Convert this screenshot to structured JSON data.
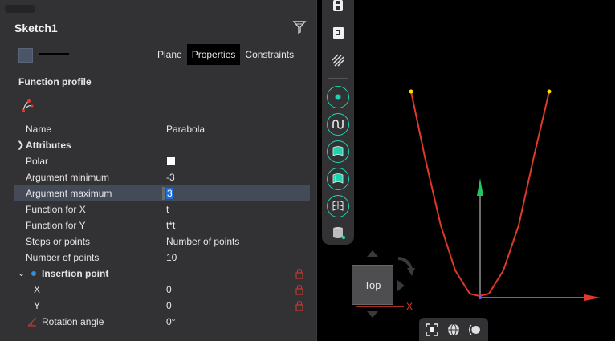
{
  "panel": {
    "title": "Sketch1",
    "tabs": [
      {
        "label": "Plane"
      },
      {
        "label": "Properties"
      },
      {
        "label": "Constraints"
      }
    ],
    "section_title": "Function profile",
    "rows": {
      "name": {
        "label": "Name",
        "value": "Parabola"
      },
      "attributes": {
        "label": "Attributes"
      },
      "polar": {
        "label": "Polar",
        "checked": false
      },
      "arg_min": {
        "label": "Argument minimum",
        "value": "-3"
      },
      "arg_max": {
        "label": "Argument maximum",
        "value": "3"
      },
      "func_x": {
        "label": "Function for X",
        "value": "t"
      },
      "func_y": {
        "label": "Function for Y",
        "value": "t*t"
      },
      "steps": {
        "label": "Steps or points",
        "value": "Number of points"
      },
      "num_points": {
        "label": "Number of points",
        "value": "10"
      },
      "insertion": {
        "label": "Insertion point"
      },
      "ins_x": {
        "label": "X",
        "value": "0"
      },
      "ins_y": {
        "label": "Y",
        "value": "0"
      },
      "rotation": {
        "label": "Rotation angle",
        "value": "0°"
      }
    }
  },
  "viewport": {
    "view_cube_label": "Top",
    "axis_x": "X",
    "axis_y": "Y",
    "curve_color": "#e0392b",
    "accent_color": "#1dd3b0"
  },
  "toolbar_icons": [
    "save-icon",
    "export-icon",
    "hatch-icon",
    "point-icon",
    "curve-icon",
    "surface-icon",
    "surface-split-icon",
    "grid-surface-icon",
    "solid-icon"
  ],
  "bottom_icons": [
    "zoom-fit-icon",
    "shading-icon",
    "render-icon"
  ]
}
